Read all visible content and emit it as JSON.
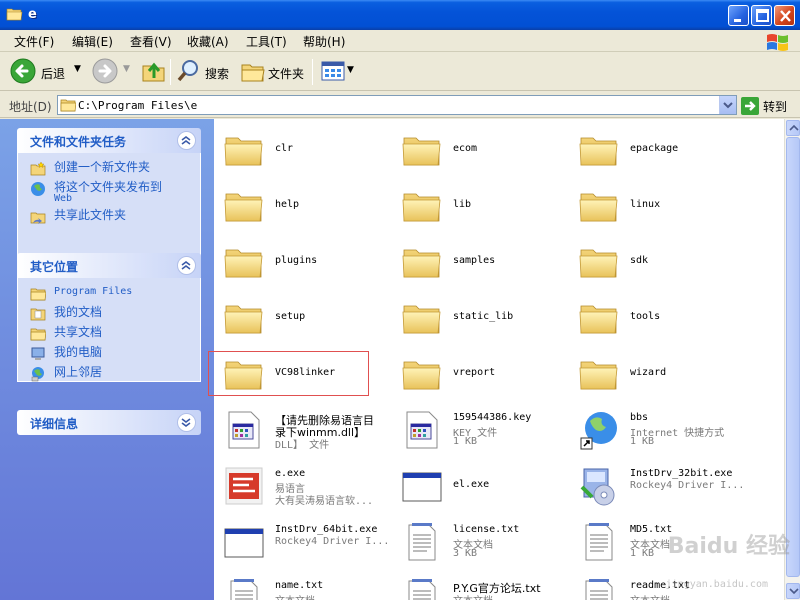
{
  "window": {
    "title": "e"
  },
  "menu": [
    "文件(F)",
    "编辑(E)",
    "查看(V)",
    "收藏(A)",
    "工具(T)",
    "帮助(H)"
  ],
  "toolbar": {
    "back": "后退",
    "search": "搜索",
    "folders": "文件夹"
  },
  "address": {
    "label": "地址(D)",
    "path": "C:\\Program Files\\e",
    "go": "转到"
  },
  "tasks_panel": {
    "title": "文件和文件夹任务",
    "items": [
      "创建一个新文件夹",
      "将这个文件夹发布到",
      "Web",
      "共享此文件夹"
    ]
  },
  "places_panel": {
    "title": "其它位置",
    "items": [
      "Program Files",
      "我的文档",
      "共享文档",
      "我的电脑",
      "网上邻居"
    ]
  },
  "details_panel": {
    "title": "详细信息"
  },
  "files": [
    {
      "name": "clr"
    },
    {
      "name": "ecom"
    },
    {
      "name": "epackage"
    },
    {
      "name": "help"
    },
    {
      "name": "lib"
    },
    {
      "name": "linux"
    },
    {
      "name": "plugins"
    },
    {
      "name": "samples"
    },
    {
      "name": "sdk"
    },
    {
      "name": "setup"
    },
    {
      "name": "static_lib"
    },
    {
      "name": "tools"
    },
    {
      "name": "VC98linker"
    },
    {
      "name": "vreport"
    },
    {
      "name": "wizard"
    },
    {
      "name": "【请先删除易语言目",
      "line2": "录下winmm.dll】",
      "line3": "DLL】 文件"
    },
    {
      "name": "159544386.key",
      "line2": "KEY 文件",
      "line3": "1 KB"
    },
    {
      "name": "bbs",
      "line2": "Internet 快捷方式",
      "line3": "1 KB"
    },
    {
      "name": "e.exe",
      "line2": "易语言",
      "line3": "大有吴涛易语言软..."
    },
    {
      "name": "el.exe"
    },
    {
      "name": "InstDrv_32bit.exe",
      "line2": "Rockey4 Driver I..."
    },
    {
      "name": "InstDrv_64bit.exe",
      "line2": "Rockey4 Driver I..."
    },
    {
      "name": "license.txt",
      "line2": "文本文档",
      "line3": "3 KB"
    },
    {
      "name": "MD5.txt",
      "line2": "文本文档",
      "line3": "1 KB"
    },
    {
      "name": "name.txt",
      "line2": "文本文档"
    },
    {
      "name": "P.Y.G官方论坛.txt",
      "line2": "文本文档"
    },
    {
      "name": "readme.txt",
      "line2": "文本文档"
    }
  ],
  "watermark": {
    "text": "Baidu 经验",
    "url": "jingyan.baidu.com"
  }
}
